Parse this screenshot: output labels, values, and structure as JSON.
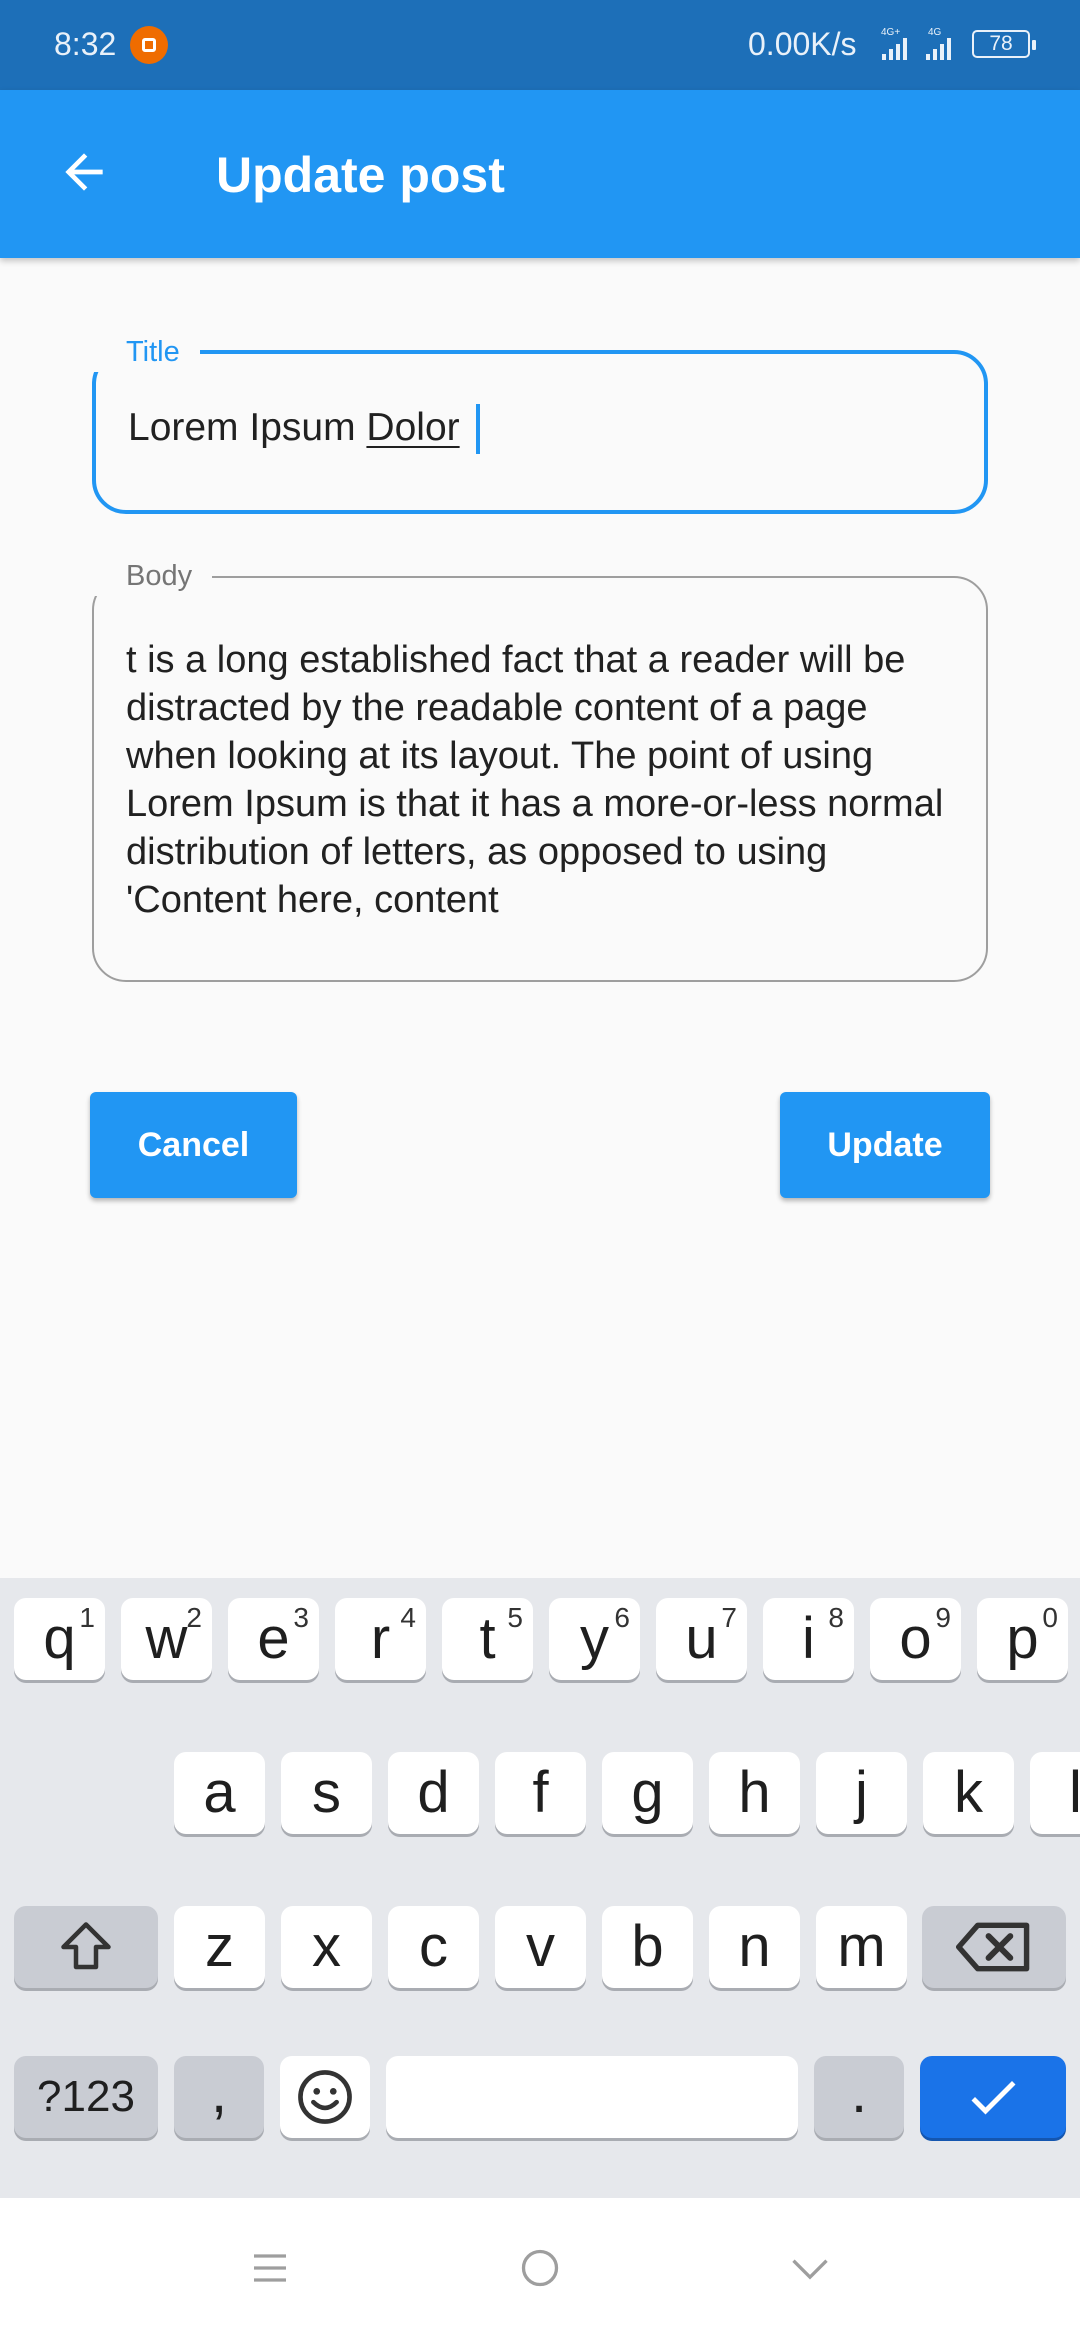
{
  "status_bar": {
    "time": "8:32",
    "network_speed": "0.00K/s",
    "signal_1": "4G+",
    "signal_2": "4G",
    "battery": "78"
  },
  "app_bar": {
    "title": "Update post",
    "back_icon": "arrow-left-icon"
  },
  "form": {
    "title_field": {
      "label": "Title",
      "value_plain": "Lorem Ipsum ",
      "value_composing": "Dolor"
    },
    "body_field": {
      "label": "Body",
      "value": "t is a long established fact that a reader will be distracted by the readable content of a page when looking at its layout. The point of using Lorem Ipsum is that it has a more-or-less normal distribution of letters, as opposed to using 'Content here, content"
    }
  },
  "buttons": {
    "cancel": "Cancel",
    "update": "Update"
  },
  "keyboard": {
    "row1": [
      {
        "key": "q",
        "hint": "1"
      },
      {
        "key": "w",
        "hint": "2"
      },
      {
        "key": "e",
        "hint": "3"
      },
      {
        "key": "r",
        "hint": "4"
      },
      {
        "key": "t",
        "hint": "5"
      },
      {
        "key": "y",
        "hint": "6"
      },
      {
        "key": "u",
        "hint": "7"
      },
      {
        "key": "i",
        "hint": "8"
      },
      {
        "key": "o",
        "hint": "9"
      },
      {
        "key": "p",
        "hint": "0"
      }
    ],
    "row2": [
      "a",
      "s",
      "d",
      "f",
      "g",
      "h",
      "j",
      "k",
      "l"
    ],
    "row3": [
      "z",
      "x",
      "c",
      "v",
      "b",
      "n",
      "m"
    ],
    "symbols_key": "?123",
    "comma_key": ",",
    "period_key": ".",
    "shift_icon": "shift-icon",
    "backspace_icon": "backspace-icon",
    "emoji_icon": "emoji-icon",
    "done_icon": "check-icon"
  },
  "nav_bar": {
    "menu_icon": "menu-icon",
    "home_icon": "home-circle-icon",
    "back_icon": "chevron-down-icon"
  },
  "colors": {
    "primary": "#2196f3",
    "status_bar": "#1d6fb8",
    "keyboard_bg": "#e6e8ec",
    "done_key": "#1a73e8"
  }
}
